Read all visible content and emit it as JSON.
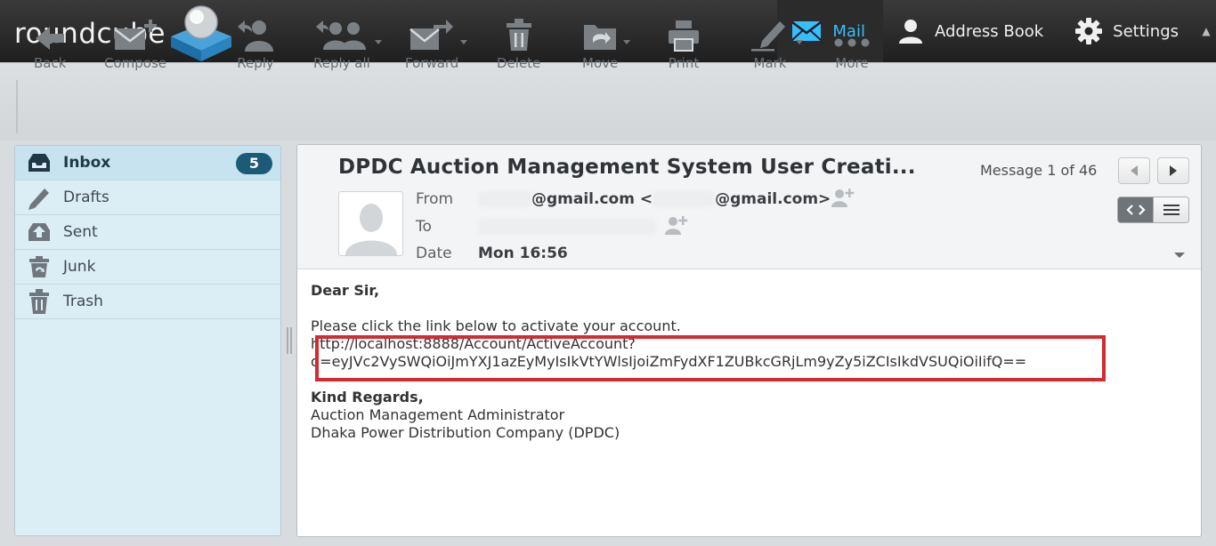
{
  "app": {
    "logo_text": "roundcube"
  },
  "topnav": [
    {
      "label": "Mail",
      "icon": "mail-icon",
      "active": true
    },
    {
      "label": "Address Book",
      "icon": "person-icon",
      "active": false
    },
    {
      "label": "Settings",
      "icon": "gear-icon",
      "active": false
    }
  ],
  "toolbar": {
    "back": "Back",
    "compose": "Compose",
    "reply": "Reply",
    "reply_all": "Reply all",
    "forward": "Forward",
    "delete": "Delete",
    "move": "Move",
    "print": "Print",
    "mark": "Mark",
    "more": "More"
  },
  "folders": [
    {
      "label": "Inbox",
      "icon": "inbox-icon",
      "badge": "5",
      "selected": true
    },
    {
      "label": "Drafts",
      "icon": "pencil-icon"
    },
    {
      "label": "Sent",
      "icon": "sent-icon"
    },
    {
      "label": "Junk",
      "icon": "junk-icon"
    },
    {
      "label": "Trash",
      "icon": "trash-icon"
    }
  ],
  "message": {
    "subject": "DPDC Auction Management System User Creati...",
    "counter": "Message 1 of 46",
    "from_label": "From",
    "to_label": "To",
    "date_label": "Date",
    "from_value_a": "@gmail.com <",
    "from_value_b": "@gmail.com>",
    "date_value": "Mon 16:56",
    "body": {
      "greeting": "Dear Sir,",
      "line1": "Please click the link below to activate your account.",
      "link1": "http://localhost:8888/Account/ActiveAccount?",
      "link2": "q=eyJVc2VySWQiOiJmYXJ1azEyMyIsIkVtYWlsIjoiZmFydXF1ZUBkcGRjLm9yZy5iZCIsIkdVSUQiOiIifQ==",
      "closing": "Kind Regards,",
      "sig1": "Auction Management Administrator",
      "sig2": "Dhaka Power Distribution Company (DPDC)"
    }
  },
  "colors": {
    "accent": "#37beff",
    "badge": "#1c5b76",
    "highlight": "#d42b30"
  }
}
